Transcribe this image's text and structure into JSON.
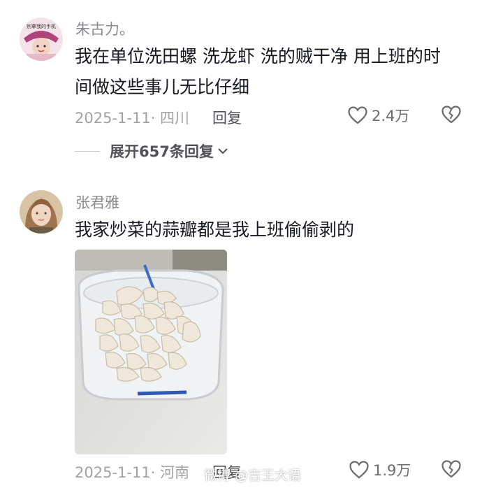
{
  "comments": [
    {
      "username": "朱古力。",
      "text_line1": "我在单位洗田螺 洗龙虾 洗的贼干净 用上班的时",
      "text_line2": "间做这些事儿无比仔细",
      "date_location": "2025-1-11· 四川",
      "reply_label": "回复",
      "likes": "2.4万",
      "expand_label": "展开657条回复",
      "avatar_caption": "别拿我的手机"
    },
    {
      "username": "张君雅",
      "text": "我家炒菜的蒜瓣都是我上班偷偷剥的",
      "date_location": "2025-1-11· 河南",
      "reply_label": "回复",
      "likes": "1.9万"
    }
  ],
  "watermark": "微博 @吉王大语",
  "icons": {
    "like": "heart-outline-icon",
    "dislike": "broken-heart-icon",
    "expand": "chevron-down-icon"
  }
}
